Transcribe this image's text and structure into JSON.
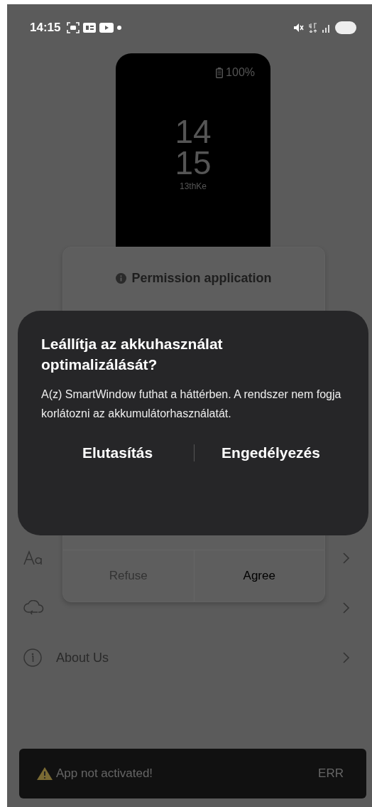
{
  "status_bar": {
    "time": "14:15"
  },
  "watch_preview": {
    "battery": "100%",
    "hour": "14",
    "minute": "15",
    "caption": "13thKe"
  },
  "menu": [
    {
      "kind": "font"
    },
    {
      "kind": "cloud"
    },
    {
      "kind": "info",
      "label": "About Us"
    }
  ],
  "permission_dialog": {
    "title": "Permission application",
    "buttons": [
      {
        "label": "Refuse",
        "kind": "secondary"
      },
      {
        "label": "Agree",
        "kind": "primary"
      }
    ]
  },
  "system_dialog": {
    "title": "Leállítja az akkuhasználat optimalizálását?",
    "message": "A(z) SmartWindow futhat a háttérben. A rendszer nem fogja korlátozni az akkumulátorhasználatát.",
    "buttons": [
      {
        "label": "Elutasítás"
      },
      {
        "label": "Engedélyezés"
      }
    ]
  },
  "banner": {
    "text": "App not activated!",
    "code": "ERR"
  }
}
